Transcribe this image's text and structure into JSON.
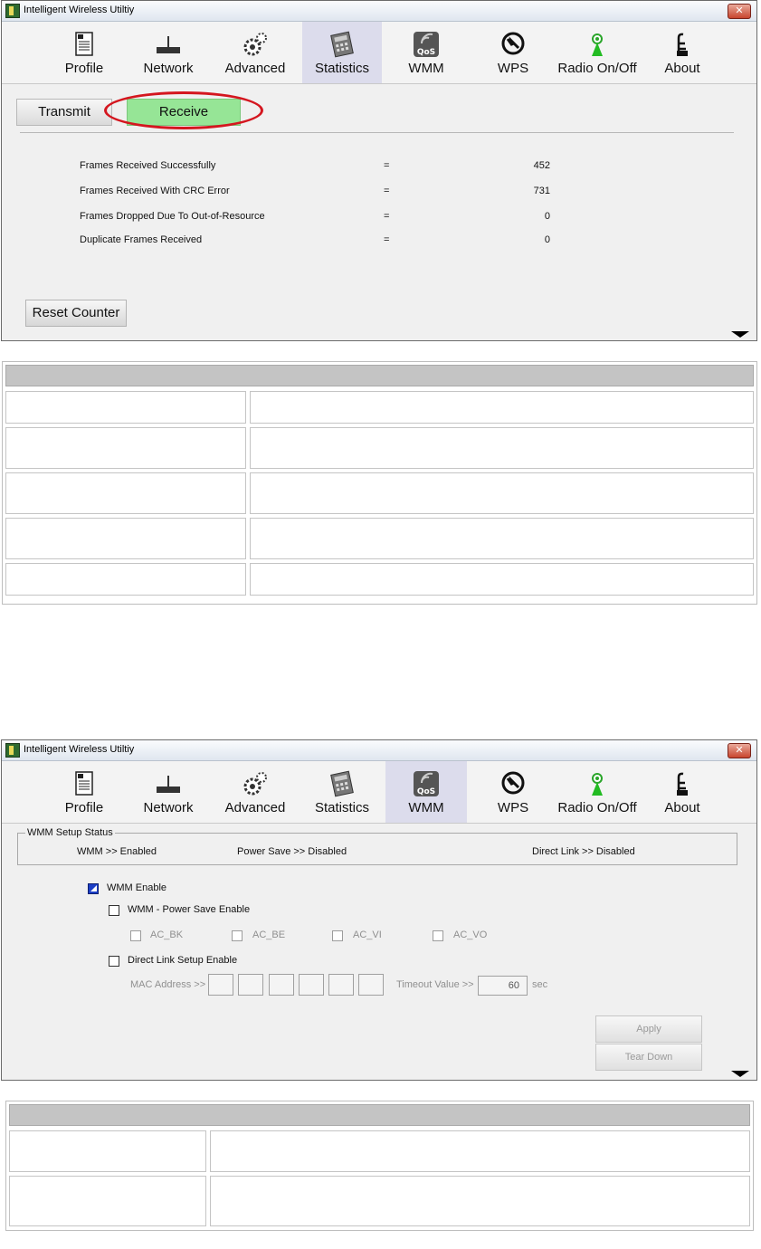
{
  "window_title": "Intelligent Wireless Utiltiy",
  "close_symbol": "✕",
  "toolbar": [
    {
      "label": "Profile",
      "icon": "profile-icon"
    },
    {
      "label": "Network",
      "icon": "network-icon"
    },
    {
      "label": "Advanced",
      "icon": "advanced-icon"
    },
    {
      "label": "Statistics",
      "icon": "statistics-icon"
    },
    {
      "label": "WMM",
      "icon": "wmm-icon",
      "icon_text": "QoS"
    },
    {
      "label": "WPS",
      "icon": "wps-icon"
    },
    {
      "label": "Radio On/Off",
      "icon": "radio-icon"
    },
    {
      "label": "About",
      "icon": "about-icon"
    }
  ],
  "statistics": {
    "tabs": {
      "transmit": "Transmit",
      "receive": "Receive"
    },
    "rows": [
      {
        "label": "Frames Received Successfully",
        "eq": "=",
        "value": "452"
      },
      {
        "label": "Frames Received With CRC Error",
        "eq": "=",
        "value": "731"
      },
      {
        "label": "Frames Dropped Due To Out-of-Resource",
        "eq": "=",
        "value": "0"
      },
      {
        "label": "Duplicate Frames Received",
        "eq": "=",
        "value": "0"
      }
    ],
    "reset_button": "Reset Counter"
  },
  "wmm": {
    "status_group_title": "WMM Setup Status",
    "wmm_status": "WMM >> Enabled",
    "power_save_status": "Power Save >> Disabled",
    "direct_link_status": "Direct Link >> Disabled",
    "wmm_enable": {
      "label": "WMM Enable",
      "checked": true
    },
    "power_save_enable": {
      "label": "WMM - Power Save Enable",
      "checked": false
    },
    "ac": [
      "AC_BK",
      "AC_BE",
      "AC_VI",
      "AC_VO"
    ],
    "direct_link_enable": {
      "label": "Direct Link Setup Enable",
      "checked": false
    },
    "mac_label": "MAC Address >>",
    "timeout_label": "Timeout Value >>",
    "timeout_value": "60",
    "timeout_unit": "sec",
    "apply_button": "Apply",
    "tear_down_button": "Tear Down"
  }
}
